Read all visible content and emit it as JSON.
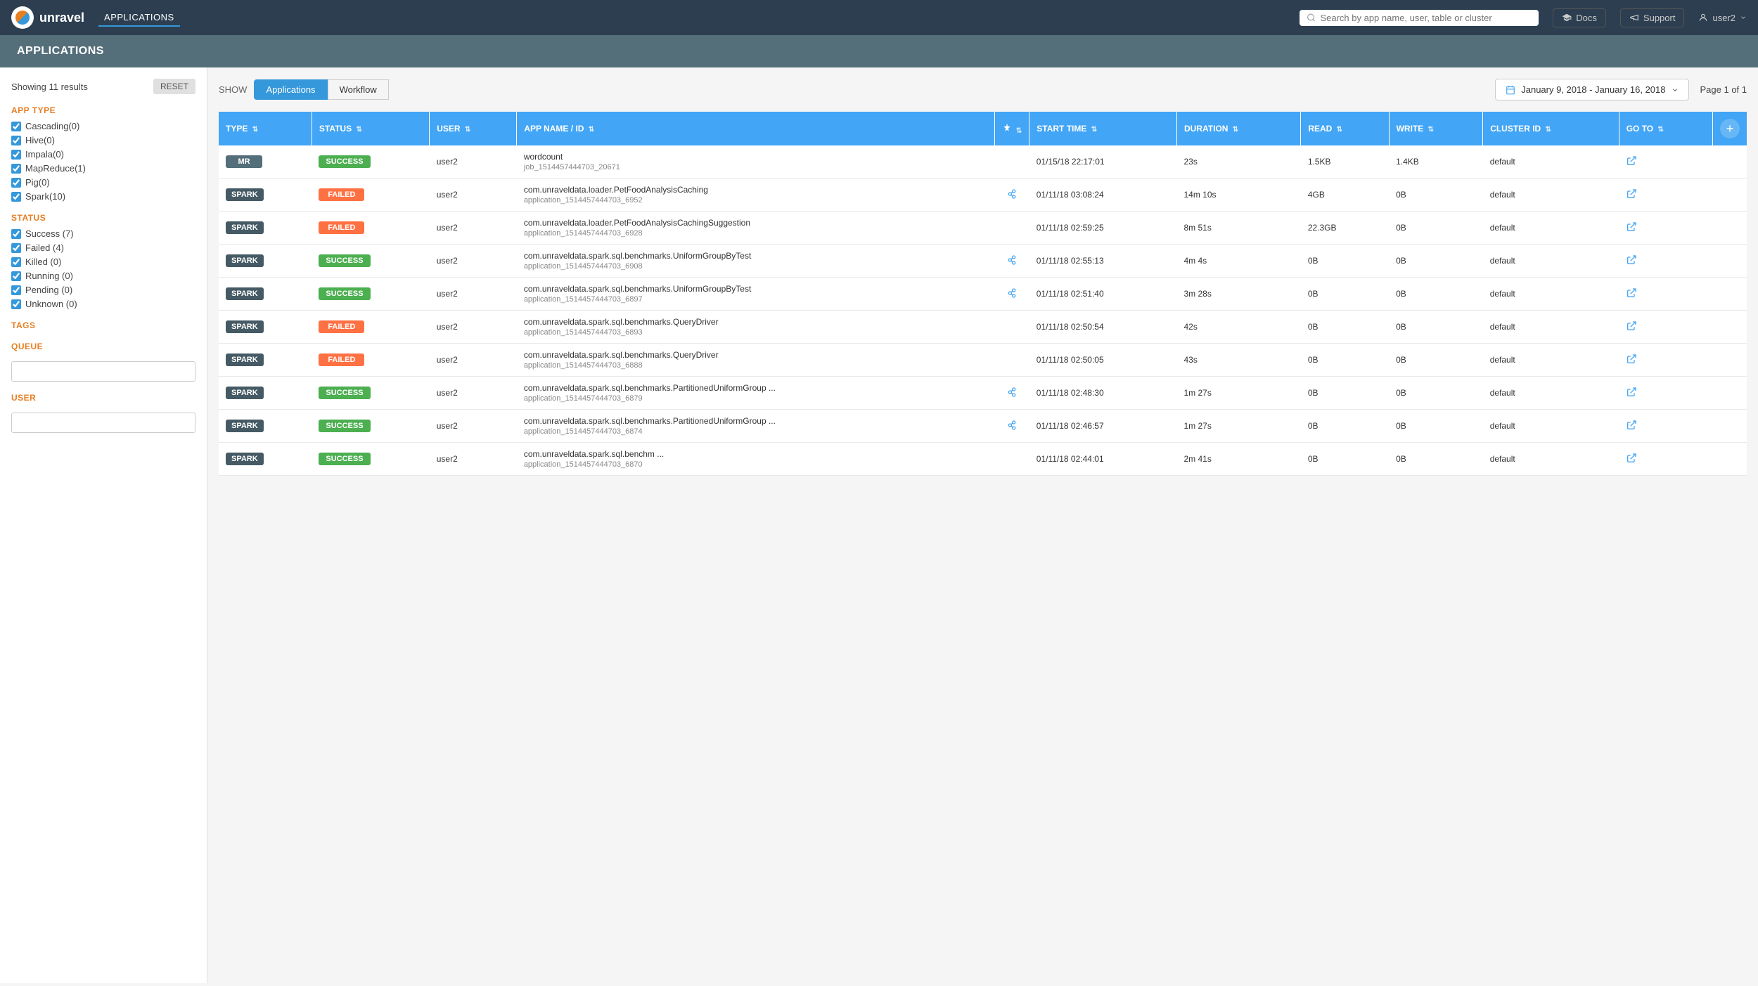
{
  "app": {
    "title": "unravel",
    "nav": {
      "links": [
        "APPLICATIONS"
      ],
      "active": "APPLICATIONS"
    },
    "search_placeholder": "Search by app name, user, table or cluster",
    "docs_label": "Docs",
    "support_label": "Support",
    "user_label": "user2"
  },
  "page_header": "APPLICATIONS",
  "tabs": {
    "show_label": "SHOW",
    "applications_label": "Applications",
    "workflow_label": "Workflow",
    "active": "Applications"
  },
  "date_range": "January 9, 2018 - January 16, 2018",
  "pagination": "Page 1 of 1",
  "sidebar": {
    "showing_text": "Showing 11 results",
    "reset_label": "RESET",
    "app_type_title": "APP TYPE",
    "app_types": [
      {
        "label": "Cascading(0)",
        "checked": true
      },
      {
        "label": "Hive(0)",
        "checked": true
      },
      {
        "label": "Impala(0)",
        "checked": true
      },
      {
        "label": "MapReduce(1)",
        "checked": true
      },
      {
        "label": "Pig(0)",
        "checked": true
      },
      {
        "label": "Spark(10)",
        "checked": true
      }
    ],
    "status_title": "STATUS",
    "statuses": [
      {
        "label": "Success (7)",
        "checked": true
      },
      {
        "label": "Failed (4)",
        "checked": true
      },
      {
        "label": "Killed (0)",
        "checked": true
      },
      {
        "label": "Running (0)",
        "checked": true
      },
      {
        "label": "Pending (0)",
        "checked": true
      },
      {
        "label": "Unknown (0)",
        "checked": true
      }
    ],
    "tags_title": "TAGS",
    "queue_title": "QUEUE",
    "queue_placeholder": "",
    "user_title": "USER",
    "user_placeholder": ""
  },
  "table": {
    "columns": [
      {
        "key": "type",
        "label": "TYPE"
      },
      {
        "key": "status",
        "label": "STATUS"
      },
      {
        "key": "user",
        "label": "USER"
      },
      {
        "key": "app_name",
        "label": "APP NAME / ID"
      },
      {
        "key": "flag",
        "label": "⚠"
      },
      {
        "key": "start_time",
        "label": "START TIME"
      },
      {
        "key": "duration",
        "label": "DURATION"
      },
      {
        "key": "read",
        "label": "READ"
      },
      {
        "key": "write",
        "label": "WRITE"
      },
      {
        "key": "cluster_id",
        "label": "CLUSTER ID"
      },
      {
        "key": "goto",
        "label": "GO TO"
      }
    ],
    "rows": [
      {
        "type": "MR",
        "type_class": "mr",
        "status": "SUCCESS",
        "status_class": "success",
        "user": "user2",
        "app_name": "wordcount",
        "app_id": "job_1514457444703_20671",
        "has_flag": false,
        "has_workflow": false,
        "start_time": "01/15/18 22:17:01",
        "duration": "23s",
        "read": "1.5KB",
        "write": "1.4KB",
        "cluster_id": "default"
      },
      {
        "type": "SPARK",
        "type_class": "spark",
        "status": "FAILED",
        "status_class": "failed",
        "user": "user2",
        "app_name": "com.unraveldata.loader.PetFoodAnalysisCaching",
        "app_id": "application_1514457444703_6952",
        "has_flag": false,
        "has_workflow": true,
        "start_time": "01/11/18 03:08:24",
        "duration": "14m 10s",
        "read": "4GB",
        "write": "0B",
        "cluster_id": "default"
      },
      {
        "type": "SPARK",
        "type_class": "spark",
        "status": "FAILED",
        "status_class": "failed",
        "user": "user2",
        "app_name": "com.unraveldata.loader.PetFoodAnalysisCachingSuggestion",
        "app_id": "application_1514457444703_6928",
        "has_flag": false,
        "has_workflow": false,
        "start_time": "01/11/18 02:59:25",
        "duration": "8m 51s",
        "read": "22.3GB",
        "write": "0B",
        "cluster_id": "default"
      },
      {
        "type": "SPARK",
        "type_class": "spark",
        "status": "SUCCESS",
        "status_class": "success",
        "user": "user2",
        "app_name": "com.unraveldata.spark.sql.benchmarks.UniformGroupByTest",
        "app_id": "application_1514457444703_6908",
        "has_flag": false,
        "has_workflow": true,
        "start_time": "01/11/18 02:55:13",
        "duration": "4m 4s",
        "read": "0B",
        "write": "0B",
        "cluster_id": "default"
      },
      {
        "type": "SPARK",
        "type_class": "spark",
        "status": "SUCCESS",
        "status_class": "success",
        "user": "user2",
        "app_name": "com.unraveldata.spark.sql.benchmarks.UniformGroupByTest",
        "app_id": "application_1514457444703_6897",
        "has_flag": false,
        "has_workflow": true,
        "start_time": "01/11/18 02:51:40",
        "duration": "3m 28s",
        "read": "0B",
        "write": "0B",
        "cluster_id": "default"
      },
      {
        "type": "SPARK",
        "type_class": "spark",
        "status": "FAILED",
        "status_class": "failed",
        "user": "user2",
        "app_name": "com.unraveldata.spark.sql.benchmarks.QueryDriver",
        "app_id": "application_1514457444703_6893",
        "has_flag": false,
        "has_workflow": false,
        "start_time": "01/11/18 02:50:54",
        "duration": "42s",
        "read": "0B",
        "write": "0B",
        "cluster_id": "default"
      },
      {
        "type": "SPARK",
        "type_class": "spark",
        "status": "FAILED",
        "status_class": "failed",
        "user": "user2",
        "app_name": "com.unraveldata.spark.sql.benchmarks.QueryDriver",
        "app_id": "application_1514457444703_6888",
        "has_flag": false,
        "has_workflow": false,
        "start_time": "01/11/18 02:50:05",
        "duration": "43s",
        "read": "0B",
        "write": "0B",
        "cluster_id": "default"
      },
      {
        "type": "SPARK",
        "type_class": "spark",
        "status": "SUCCESS",
        "status_class": "success",
        "user": "user2",
        "app_name": "com.unraveldata.spark.sql.benchmarks.PartitionedUniformGroup ...",
        "app_id": "application_1514457444703_6879",
        "has_flag": false,
        "has_workflow": true,
        "start_time": "01/11/18 02:48:30",
        "duration": "1m 27s",
        "read": "0B",
        "write": "0B",
        "cluster_id": "default"
      },
      {
        "type": "SPARK",
        "type_class": "spark",
        "status": "SUCCESS",
        "status_class": "success",
        "user": "user2",
        "app_name": "com.unraveldata.spark.sql.benchmarks.PartitionedUniformGroup ...",
        "app_id": "application_1514457444703_6874",
        "has_flag": false,
        "has_workflow": true,
        "start_time": "01/11/18 02:46:57",
        "duration": "1m 27s",
        "read": "0B",
        "write": "0B",
        "cluster_id": "default"
      },
      {
        "type": "SPARK",
        "type_class": "spark",
        "status": "SUCCESS",
        "status_class": "success",
        "user": "user2",
        "app_name": "com.unraveldata.spark.sql.benchm ...",
        "app_id": "application_1514457444703_6870",
        "has_flag": false,
        "has_workflow": false,
        "start_time": "01/11/18 02:44:01",
        "duration": "2m 41s",
        "read": "0B",
        "write": "0B",
        "cluster_id": "default"
      }
    ]
  }
}
